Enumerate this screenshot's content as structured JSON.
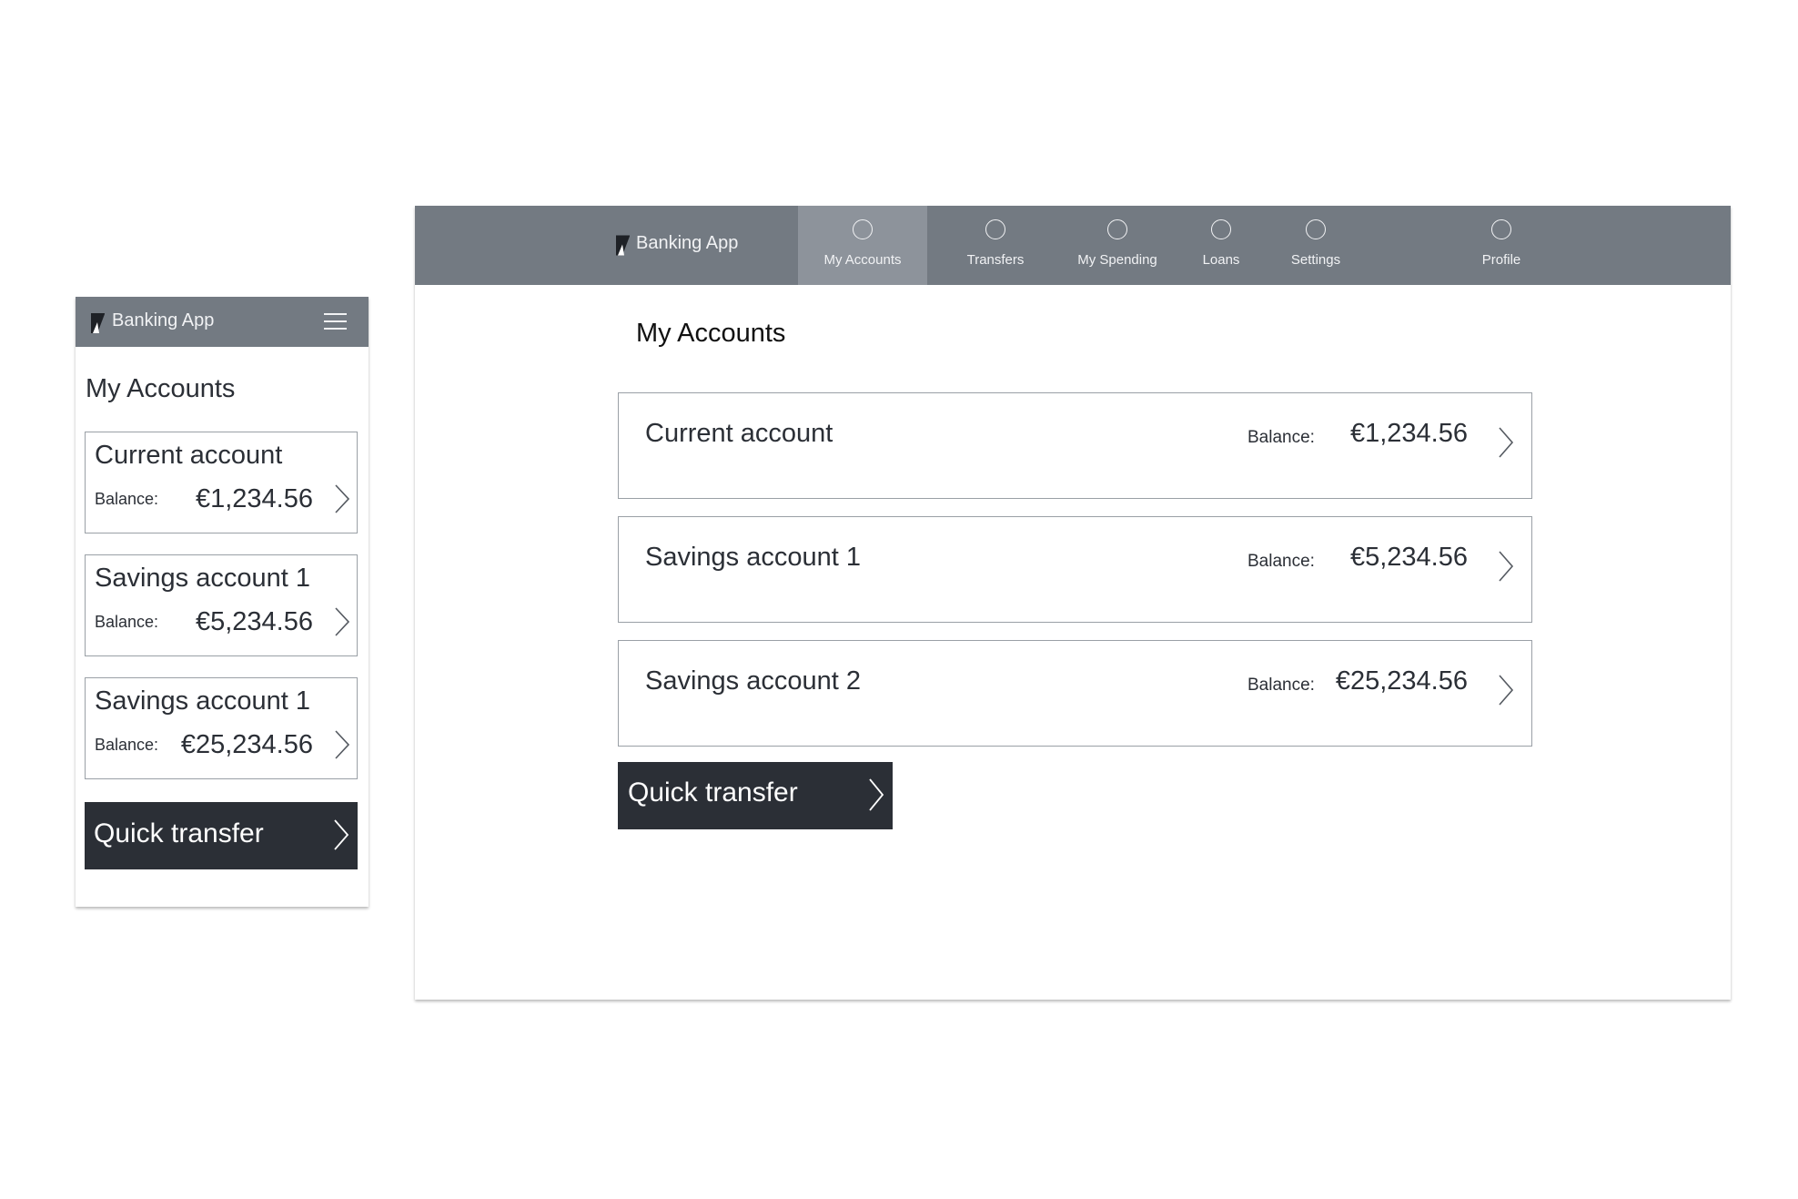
{
  "app": {
    "name": "Banking App"
  },
  "mobile": {
    "title": "My Accounts",
    "accounts": [
      {
        "name": "Current account",
        "balance_label": "Balance:",
        "balance": "€1,234.56"
      },
      {
        "name": "Savings account 1",
        "balance_label": "Balance:",
        "balance": "€5,234.56"
      },
      {
        "name": "Savings account 1",
        "balance_label": "Balance:",
        "balance": "€25,234.56"
      }
    ],
    "quick_transfer": "Quick transfer",
    "icons": {
      "logo": "bank-logo-icon",
      "menu": "hamburger-menu-icon",
      "chevron": "chevron-right-icon"
    }
  },
  "desktop": {
    "nav": [
      {
        "label": "My Accounts",
        "active": true,
        "icon": "circle-icon"
      },
      {
        "label": "Transfers",
        "active": false,
        "icon": "circle-icon"
      },
      {
        "label": "My Spending",
        "active": false,
        "icon": "circle-icon"
      },
      {
        "label": "Loans",
        "active": false,
        "icon": "circle-icon"
      },
      {
        "label": "Settings",
        "active": false,
        "icon": "circle-icon"
      },
      {
        "label": "Profile",
        "active": false,
        "icon": "circle-icon"
      }
    ],
    "title": "My Accounts",
    "accounts": [
      {
        "name": "Current account",
        "balance_label": "Balance:",
        "balance": "€1,234.56"
      },
      {
        "name": "Savings account 1",
        "balance_label": "Balance:",
        "balance": "€5,234.56"
      },
      {
        "name": "Savings account 2",
        "balance_label": "Balance:",
        "balance": "€25,234.56"
      }
    ],
    "quick_transfer": "Quick transfer"
  },
  "colors": {
    "header": "#737a82",
    "nav_active": "#8d939b",
    "button": "#2b2f36",
    "border": "#9aa0a6"
  }
}
